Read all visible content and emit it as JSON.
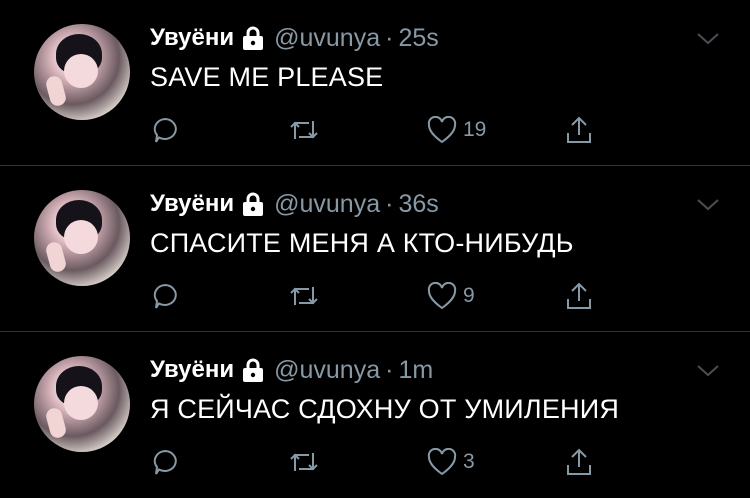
{
  "colors": {
    "background": "#000000",
    "text": "#ffffff",
    "muted": "#8899a6",
    "divider": "#2f3336"
  },
  "tweets": [
    {
      "name": "Увуёни",
      "handle": "@uvunya",
      "separator": "·",
      "time": "25s",
      "text": "SAVE ME PLEASE",
      "likes": "19"
    },
    {
      "name": "Увуёни",
      "handle": "@uvunya",
      "separator": "·",
      "time": "36s",
      "text": "СПАСИТЕ МЕНЯ А КТО-НИБУДЬ",
      "likes": "9"
    },
    {
      "name": "Увуёни",
      "handle": "@uvunya",
      "separator": "·",
      "time": "1m",
      "text": "Я СЕЙЧАС СДОХНУ ОТ УМИЛЕНИЯ",
      "likes": "3"
    }
  ],
  "icons": {
    "lock": "lock-icon",
    "more": "chevron-down-icon",
    "reply": "reply-icon",
    "retweet": "retweet-icon",
    "like": "heart-icon",
    "share": "share-icon"
  }
}
